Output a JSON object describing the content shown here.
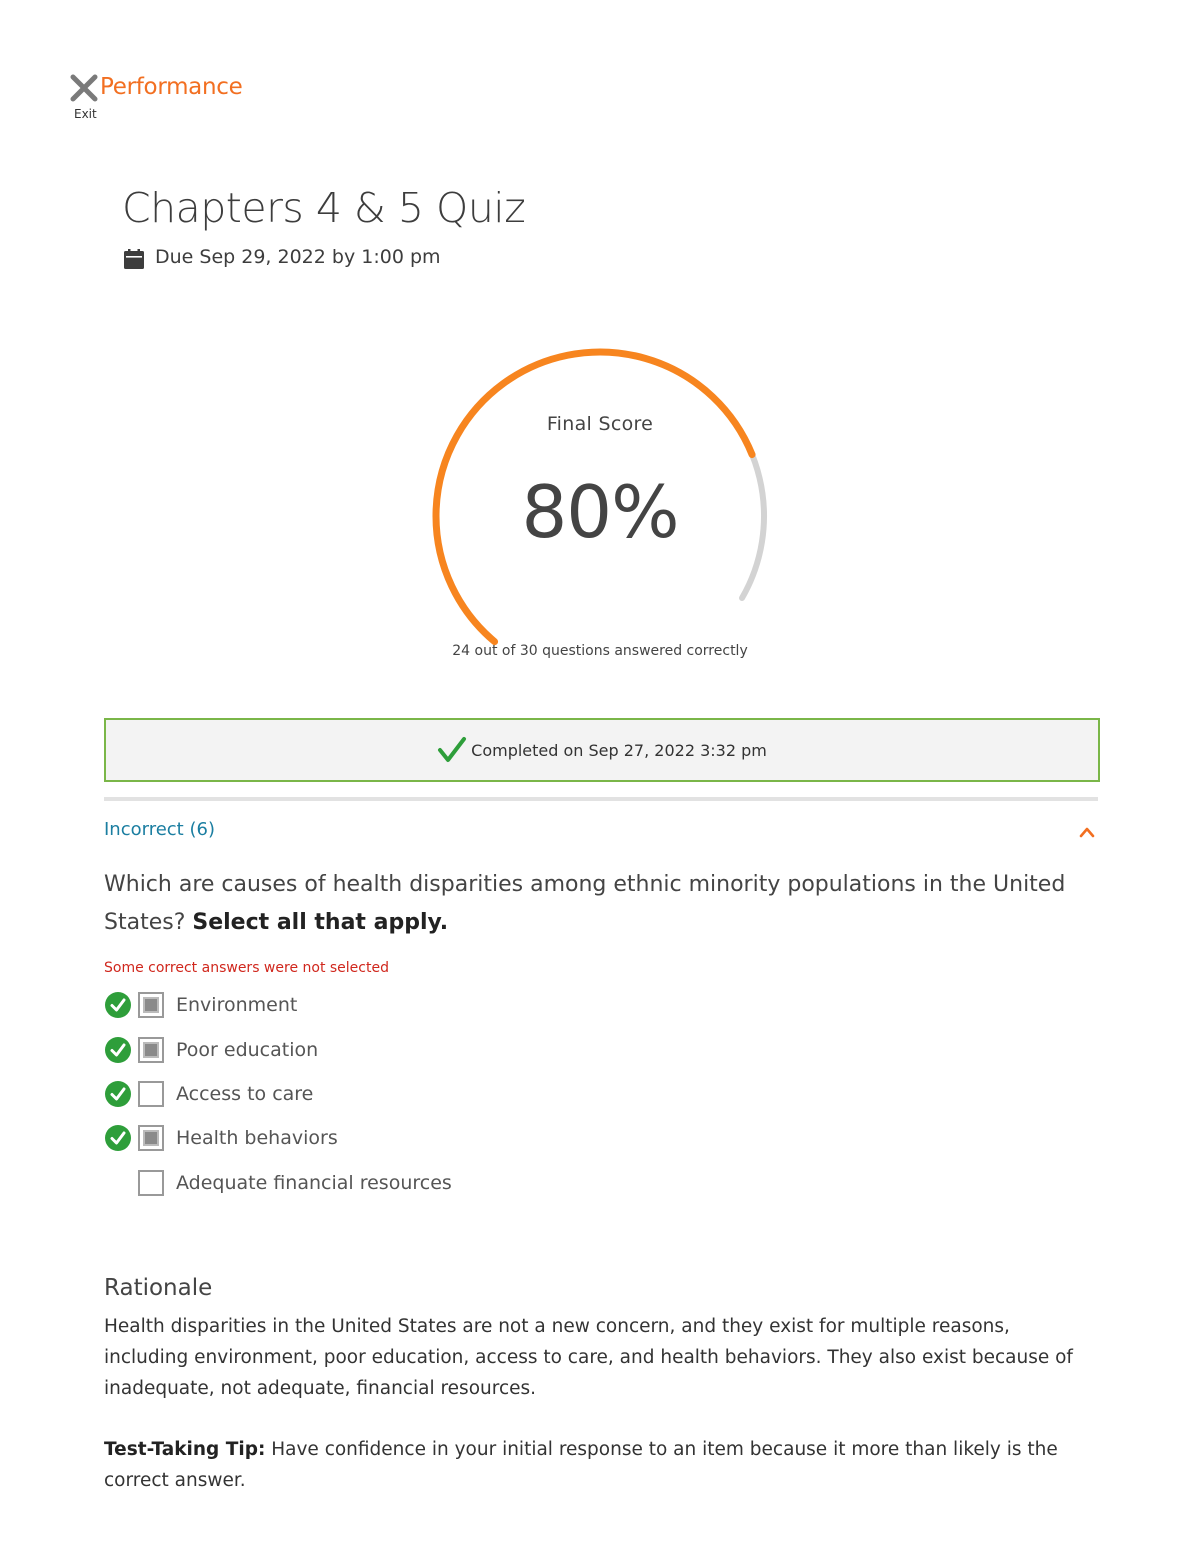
{
  "header": {
    "app_title": "Performance",
    "exit_label": "Exit",
    "exit_icon": "close-icon"
  },
  "quiz": {
    "title": "Chapters 4 & 5 Quiz",
    "due": "Due Sep 29, 2022 by 1:00 pm",
    "due_icon": "calendar-icon"
  },
  "score": {
    "label": "Final Score",
    "display": "80%",
    "fraction": 0.8,
    "caption": "24 out of 30 questions answered correctly",
    "colors": {
      "progress": "#f7851f",
      "track": "#d3d3d3"
    }
  },
  "status": {
    "completed": "Completed on Sep 27, 2022 3:32 pm",
    "icon": "checkmark-icon",
    "colors": {
      "border": "#7ab648",
      "check": "#2e9e3a"
    }
  },
  "section": {
    "label": "Incorrect (6)",
    "toggle_icon": "chevron-up-icon"
  },
  "question": {
    "text": "Which are causes of health disparities among ethnic minority populations in the United States?",
    "instruction": "Select all that apply.",
    "feedback": "Some correct answers were not selected",
    "options": [
      {
        "label": "Environment",
        "correct": true,
        "selected": true
      },
      {
        "label": "Poor education",
        "correct": true,
        "selected": true
      },
      {
        "label": "Access to care",
        "correct": true,
        "selected": false
      },
      {
        "label": "Health behaviors",
        "correct": true,
        "selected": true
      },
      {
        "label": "Adequate financial resources",
        "correct": false,
        "selected": false
      }
    ]
  },
  "rationale": {
    "title": "Rationale",
    "body": "Health disparities in the United States are not a new concern, and they exist for multiple reasons, including environment, poor education, access to care, and health behaviors. They also exist because of inadequate, not adequate, financial resources.",
    "tip_label": "Test-Taking Tip:",
    "tip_text": "Have confidence in your initial response to an item because it more than likely is the correct answer."
  }
}
